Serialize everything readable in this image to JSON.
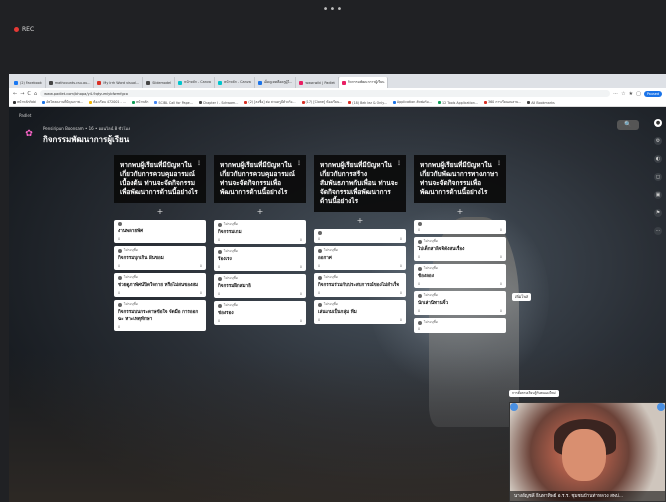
{
  "top": {
    "dots": "•••",
    "rec_label": "REC"
  },
  "browser": {
    "tabs": [
      {
        "label": "(2) Facebook",
        "color": "#1877f2"
      },
      {
        "label": "mathcounts.csu.au...",
        "color": "#444"
      },
      {
        "label": "My Irrh Word visual...",
        "color": "#d93025"
      },
      {
        "label": "Slidemodel",
        "color": "#444"
      },
      {
        "label": "หน้าหลัก - Canva",
        "color": "#00c4cc"
      },
      {
        "label": "หน้าหลัก - Canva",
        "color": "#00c4cc"
      },
      {
        "label": "เอ็ดดูเทคคือครูผู้ใ...",
        "color": "#1a73e8"
      },
      {
        "label": "www.wiki | Padlet",
        "color": "#e91e63"
      },
      {
        "label": "กิจกรรมพัฒนาการผู้เรียน",
        "color": "#e91e63"
      }
    ],
    "url": "www.padlet.com/bhopa/y4-9qtyumiybfwmfgco",
    "nav": {
      "back": "←",
      "forward": "→",
      "reload": "C",
      "home": "⌂"
    },
    "right_icons": [
      "⋯",
      "☆",
      "★",
      "▢"
    ],
    "profile_label": "Paused",
    "bookmarks": [
      {
        "label": "หน้าหลักFabi",
        "color": "#333"
      },
      {
        "label": "อัพโหลดงานที่มีคุณภาพ...",
        "color": "#1a73e8"
      },
      {
        "label": "ห้องเรียน 472001 - ...",
        "color": "#f4b400"
      },
      {
        "label": "หน้าหลัก",
        "color": "#0f9d58"
      },
      {
        "label": "SCIBL Call for Pape...",
        "color": "#4285f4"
      },
      {
        "label": "Chapter I - Schwam...",
        "color": "#444"
      },
      {
        "label": "(2) [ลงชื่อ] ต่อ สวนครูมีตัวจริง...",
        "color": "#d93025"
      },
      {
        "label": "(17) [Clone] ห้องเรียน...",
        "color": "#d93025"
      },
      {
        "label": "(18) Bek lez & Only...",
        "color": "#d93025"
      },
      {
        "label": "Application ลัทฟอร์ม...",
        "color": "#1a73e8"
      },
      {
        "label": "12 Tools Application...",
        "color": "#0f9d58"
      },
      {
        "label": "360 การเรียนอนลาย...",
        "color": "#d93025"
      },
      {
        "label": "All Bookmarks",
        "color": "#444"
      }
    ]
  },
  "padlet": {
    "breadcrumb": "Padlet",
    "author_line": "Pensiripun Boonsam • 16 • ออนไลน์ 8 ชั่วโมง",
    "title": "กิจกรรมพัฒนาการผู้เรียน",
    "avatar_emoji": "✿",
    "search_icon": "🔍",
    "sidebar_icons": [
      "●",
      "⚙",
      "◐",
      "◻",
      "▣",
      "⚑",
      "⋯"
    ],
    "add_label": "+",
    "columns": [
      {
        "heading": "หากพบผู้เรียนที่มีปัญหาในเกี่ยวกับการควบคุมอารมณ์เบื้องต้น ท่านจะจัดกิจกรรมเพื่อพัฒนาการด้านนี้อย่างไร",
        "cards": [
          {
            "author": "",
            "body": "งานพลายพัศ",
            "likes": "0",
            "comments": ""
          },
          {
            "author": "ไม่ระบุชื่อ",
            "body": "กิจกรรมบุกเกิน ฝันขอม",
            "likes": "0",
            "comments": "0"
          },
          {
            "author": "ไม่ระบุชื่อ",
            "body": "ช่วยดูภาพัศน์ปิดใจกาย หรือไม่สนของสม",
            "likes": "0",
            "comments": "0"
          },
          {
            "author": "ไม่ระบุชื่อ",
            "body": "กิจกรรมบนกระดาษข้อใจ จัดมือ การออกฉะ หาะเหตุทักษา",
            "likes": "0",
            "comments": ""
          }
        ]
      },
      {
        "heading": "หากพบผู้เรียนที่มีปัญหาในเกี่ยวกับการควบคุมอารมณ์ ท่านจะจัดกิจกรรมเพื่อพัฒนาการด้านนี้อย่างไร",
        "cards": [
          {
            "author": "ไม่ระบุชื่อ",
            "body": "กิจกรรมเกม",
            "likes": "0",
            "comments": "0"
          },
          {
            "author": "ไม่ระบุชื่อ",
            "body": "ร้องเรง",
            "likes": "0",
            "comments": "0"
          },
          {
            "author": "ไม่ระบุชื่อ",
            "body": "กิจกรรมฝึกสมาธิ",
            "likes": "0",
            "comments": "0"
          },
          {
            "author": "ไม่ระบุชื่อ",
            "body": "ช่องรอง",
            "likes": "0",
            "comments": "0"
          }
        ]
      },
      {
        "heading": "หากพบผู้เรียนที่มีปัญหาในเกี่ยวกับการสร้างสัมพันธภาพกับเพื่อน ท่านจะจัดกิจกรรมเพื่อพัฒนาการด้านนี้อย่างไร",
        "cards": [
          {
            "author": "",
            "body": "",
            "likes": "0",
            "comments": "0"
          },
          {
            "author": "ไม่ระบุชื่อ",
            "body": "ออกาศ",
            "likes": "0",
            "comments": "0"
          },
          {
            "author": "ไม่ระบุชื่อ",
            "body": "กิจกรรมร่วมกับประสบการณ์ของไม่สำเร็จ",
            "likes": "0",
            "comments": "0"
          },
          {
            "author": "ไม่ระบุชื่อ",
            "body": "เล่นเกมเป็นกลุ่ม ทีม",
            "likes": "0",
            "comments": "0"
          }
        ]
      },
      {
        "heading": "หากพบผู้เรียนที่มีปัญหาในเกี่ยวกับพัฒนาการทางภาษา ท่านจะจัดกิจกรรมเพื่อพัฒนาการด้านนี้อย่างไร",
        "cards": [
          {
            "author": "",
            "body": "",
            "likes": "0",
            "comments": "0"
          },
          {
            "author": "ไม่ระบุชื่อ",
            "body": "ไปเด็กสาลิจจิดังสนเรื่อง",
            "likes": "0",
            "comments": "0"
          },
          {
            "author": "ไม่ระบุชื่อ",
            "body": "ช้องลอง",
            "likes": "0",
            "comments": "0"
          },
          {
            "author": "ไม่ระบุชื่อ",
            "body": "นักเล่านิทานจิ๋ว",
            "likes": "0",
            "comments": "0"
          },
          {
            "author": "ไม่ระบุชื่อ",
            "body": "",
            "likes": "0",
            "comments": ""
          }
        ]
      }
    ],
    "tooltip_top": "เพิ่มโพส",
    "tooltip_mid": "การตั้งตามเรียนรู้กับตนเองใหม่"
  },
  "video": {
    "name": "นางอัญชลี ธินทาทิพย์ อ.ร.ร. ชุมชนบ้านท่าหลวง สพป..."
  }
}
